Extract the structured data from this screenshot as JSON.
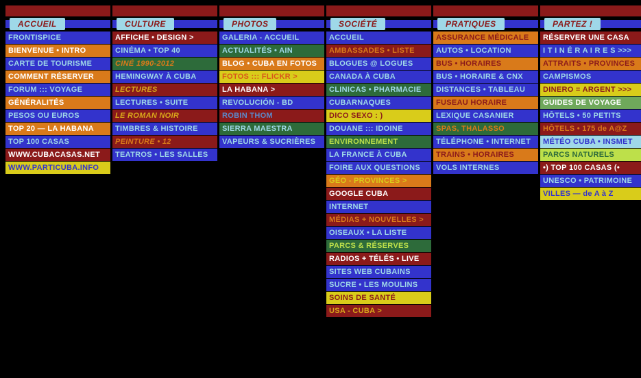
{
  "columns": [
    {
      "header": "ACCUEIL",
      "items": [
        {
          "t": "FRONTISPICE",
          "bg": "#3333cc",
          "fg": "#9fd8e8"
        },
        {
          "t": "BIENVENUE • INTRO",
          "bg": "#d97a1a",
          "fg": "#fff"
        },
        {
          "t": "CARTE DE TOURISME",
          "bg": "#3333cc",
          "fg": "#9fd8e8"
        },
        {
          "t": "COMMENT RÉSERVER",
          "bg": "#d97a1a",
          "fg": "#fff"
        },
        {
          "t": "FORUM ::: VOYAGE",
          "bg": "#3333cc",
          "fg": "#9fd8e8"
        },
        {
          "t": "GÉNÉRALITÉS",
          "bg": "#d97a1a",
          "fg": "#fff"
        },
        {
          "t": "PESOS OU EUROS",
          "bg": "#3333cc",
          "fg": "#9fd8e8"
        },
        {
          "t": "TOP 20 — LA HABANA",
          "bg": "#d97a1a",
          "fg": "#fff"
        },
        {
          "t": "TOP 100 CASAS",
          "bg": "#3333cc",
          "fg": "#9fd8e8"
        },
        {
          "t": "WWW.CUBACASAS.NET",
          "bg": "#8b1a1a",
          "fg": "#fff"
        },
        {
          "t": "WWW.PARTICUBA.INFO",
          "bg": "#d9cc1a",
          "fg": "#3333cc"
        }
      ]
    },
    {
      "header": "CULTURE",
      "items": [
        {
          "t": "AFFICHE • DESIGN >",
          "bg": "#8b1a1a",
          "fg": "#fff"
        },
        {
          "t": "CINÉMA • TOP 40",
          "bg": "#3333cc",
          "fg": "#9fd8e8"
        },
        {
          "t": "CINÉ 1990-2012",
          "bg": "#2d6b3a",
          "fg": "#d97a1a",
          "it": true
        },
        {
          "t": "HEMINGWAY À CUBA",
          "bg": "#3333cc",
          "fg": "#9fd8e8"
        },
        {
          "t": "LECTURES",
          "bg": "#8b1a1a",
          "fg": "#d9a81a",
          "it": true
        },
        {
          "t": "LECTURES • SUITE",
          "bg": "#3333cc",
          "fg": "#9fd8e8"
        },
        {
          "t": "LE ROMAN NOIR",
          "bg": "#8b1a1a",
          "fg": "#d9a81a",
          "it": true
        },
        {
          "t": "TIMBRES & HISTOIRE",
          "bg": "#3333cc",
          "fg": "#9fd8e8"
        },
        {
          "t": "PEINTURE • 12",
          "bg": "#8b1a1a",
          "fg": "#d97a1a",
          "it": true
        },
        {
          "t": "TEATROS • LES SALLES",
          "bg": "#3333cc",
          "fg": "#9fd8e8"
        }
      ]
    },
    {
      "header": "PHOTOS",
      "items": [
        {
          "t": "GALERIA - ACCUEIL",
          "bg": "#3333cc",
          "fg": "#9fd8e8"
        },
        {
          "t": "ACTUALITÉS • AIN",
          "bg": "#2d6b3a",
          "fg": "#9fd8e8"
        },
        {
          "t": "BLOG • CUBA EN FOTOS",
          "bg": "#d97a1a",
          "fg": "#fff"
        },
        {
          "t": "FOTOS ::: FLICKR >",
          "bg": "#d9cc1a",
          "fg": "#d9561a"
        },
        {
          "t": "LA HABANA >",
          "bg": "#8b1a1a",
          "fg": "#fff"
        },
        {
          "t": "REVOLUCIÓN - BD",
          "bg": "#3333cc",
          "fg": "#9fd8e8"
        },
        {
          "t": "ROBIN THOM",
          "bg": "#8b1a1a",
          "fg": "#5b8acc"
        },
        {
          "t": "SIERRA MAESTRA",
          "bg": "#2d6b3a",
          "fg": "#9fd8e8"
        },
        {
          "t": "VAPEURS & SUCRIÈRES",
          "bg": "#3333cc",
          "fg": "#9fd8e8"
        }
      ]
    },
    {
      "header": "SOCIÉTÉ",
      "items": [
        {
          "t": "ACCUEIL",
          "bg": "#3333cc",
          "fg": "#9fd8e8"
        },
        {
          "t": "AMBASSADES • LISTE",
          "bg": "#8b1a1a",
          "fg": "#d97a1a"
        },
        {
          "t": "BLOGUES @ LOGUES",
          "bg": "#3333cc",
          "fg": "#9fd8e8"
        },
        {
          "t": "CANADA À CUBA",
          "bg": "#3333cc",
          "fg": "#9fd8e8"
        },
        {
          "t": "CLINICAS • PHARMACIE",
          "bg": "#2d6b3a",
          "fg": "#9fd8e8"
        },
        {
          "t": "CUBARNAQUES",
          "bg": "#3333cc",
          "fg": "#9fd8e8"
        },
        {
          "t": "DICO SEXO : )",
          "bg": "#d9cc1a",
          "fg": "#8b1a1a"
        },
        {
          "t": "DOUANE ::: IDOINE",
          "bg": "#3333cc",
          "fg": "#9fd8e8"
        },
        {
          "t": "ENVIRONNEMENT",
          "bg": "#2d6b3a",
          "fg": "#bde04a"
        },
        {
          "t": "LA FRANCE À CUBA",
          "bg": "#3333cc",
          "fg": "#9fd8e8"
        },
        {
          "t": "FOIRE AUX QUESTIONS",
          "bg": "#3333cc",
          "fg": "#9fd8e8"
        },
        {
          "t": "GÉO - PROVINCES >",
          "bg": "#d97a1a",
          "fg": "#d9cc1a"
        },
        {
          "t": "GOOGLE CUBA",
          "bg": "#8b1a1a",
          "fg": "#fff"
        },
        {
          "t": "INTERNET",
          "bg": "#3333cc",
          "fg": "#9fd8e8"
        },
        {
          "t": "MÉDIAS + NOUVELLES >",
          "bg": "#8b1a1a",
          "fg": "#d97a1a"
        },
        {
          "t": "OISEAUX • LA LISTE",
          "bg": "#3333cc",
          "fg": "#9fd8e8"
        },
        {
          "t": "PARCS & RÉSERVES",
          "bg": "#2d6b3a",
          "fg": "#bde04a"
        },
        {
          "t": "RADIOS + TÉLÉS • LIVE",
          "bg": "#8b1a1a",
          "fg": "#fff"
        },
        {
          "t": "SITES WEB CUBAINS",
          "bg": "#3333cc",
          "fg": "#9fd8e8"
        },
        {
          "t": "SUCRE • LES MOULINS",
          "bg": "#3333cc",
          "fg": "#9fd8e8"
        },
        {
          "t": "SOINS DE SANTÉ",
          "bg": "#d9cc1a",
          "fg": "#8b1a1a"
        },
        {
          "t": "USA - CUBA >",
          "bg": "#8b1a1a",
          "fg": "#d9a81a"
        }
      ]
    },
    {
      "header": "PRATIQUES",
      "items": [
        {
          "t": "ASSURANCE MÉDICALE",
          "bg": "#d97a1a",
          "fg": "#8b1a1a"
        },
        {
          "t": "AUTOS • LOCATION",
          "bg": "#3333cc",
          "fg": "#9fd8e8"
        },
        {
          "t": "BUS • HORAIRES",
          "bg": "#d97a1a",
          "fg": "#8b1a1a"
        },
        {
          "t": "BUS • HORAIRE & CNX",
          "bg": "#3333cc",
          "fg": "#9fd8e8"
        },
        {
          "t": "DISTANCES • TABLEAU",
          "bg": "#3333cc",
          "fg": "#9fd8e8"
        },
        {
          "t": "FUSEAU HORAIRE",
          "bg": "#d97a1a",
          "fg": "#8b1a1a"
        },
        {
          "t": "LEXIQUE CASANIER",
          "bg": "#3333cc",
          "fg": "#9fd8e8"
        },
        {
          "t": "SPAS, THALASSO",
          "bg": "#2d6b3a",
          "fg": "#d97a1a"
        },
        {
          "t": "TÉLÉPHONE • INTERNET",
          "bg": "#3333cc",
          "fg": "#9fd8e8"
        },
        {
          "t": "TRAINS • HORAIRES",
          "bg": "#d97a1a",
          "fg": "#8b1a1a"
        },
        {
          "t": "VOLS INTERNES",
          "bg": "#3333cc",
          "fg": "#9fd8e8"
        }
      ]
    },
    {
      "header": "PARTEZ !",
      "items": [
        {
          "t": "RÉSERVER UNE CASA",
          "bg": "#8b1a1a",
          "fg": "#fff"
        },
        {
          "t": "I T I N É R A I R E S >>>",
          "bg": "#3333cc",
          "fg": "#9fd8e8"
        },
        {
          "t": "ATTRAITS • PROVINCES",
          "bg": "#d97a1a",
          "fg": "#8b1a1a"
        },
        {
          "t": "CAMPISMOS",
          "bg": "#3333cc",
          "fg": "#9fd8e8"
        },
        {
          "t": "DINERO = ARGENT >>>",
          "bg": "#d9cc1a",
          "fg": "#8b1a1a"
        },
        {
          "t": "GUIDES DE VOYAGE",
          "bg": "#6fa85b",
          "fg": "#fff"
        },
        {
          "t": "HÔTELS • 50 PETITS",
          "bg": "#3333cc",
          "fg": "#9fd8e8"
        },
        {
          "t": "HÔTELS • 175 de A@Z",
          "bg": "#8b1a1a",
          "fg": "#d97a1a"
        },
        {
          "t": "MÉTÉO CUBA • INSMET",
          "bg": "#9fd8e8",
          "fg": "#3333cc"
        },
        {
          "t": "PARCS NATURELS",
          "bg": "#bde04a",
          "fg": "#2d6b3a"
        },
        {
          "t": "•) TOP 100 CASAS (•",
          "bg": "#8b1a1a",
          "fg": "#fff"
        },
        {
          "t": "UNESCO • PATRIMOINE",
          "bg": "#3333cc",
          "fg": "#9fd8e8"
        },
        {
          "t": "VILLES — de A à Z",
          "bg": "#d9cc1a",
          "fg": "#3333cc"
        }
      ]
    }
  ]
}
